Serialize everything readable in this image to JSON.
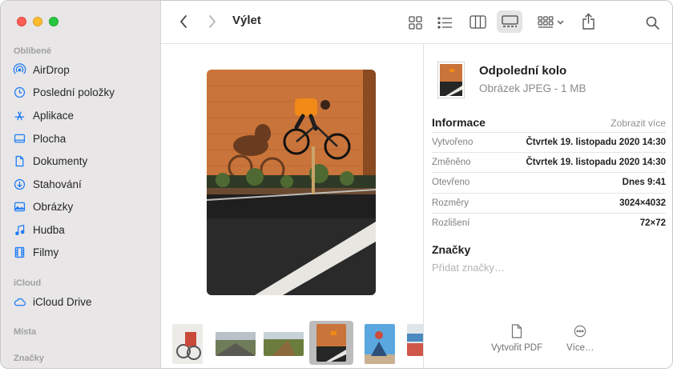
{
  "window": {
    "title": "Výlet"
  },
  "sidebar": {
    "sections": [
      {
        "title": "Oblíbené",
        "items": [
          {
            "label": "AirDrop",
            "icon": "airdrop-icon"
          },
          {
            "label": "Poslední položky",
            "icon": "clock-icon"
          },
          {
            "label": "Aplikace",
            "icon": "applications-icon"
          },
          {
            "label": "Plocha",
            "icon": "desktop-icon"
          },
          {
            "label": "Dokumenty",
            "icon": "document-icon"
          },
          {
            "label": "Stahování",
            "icon": "download-icon"
          },
          {
            "label": "Obrázky",
            "icon": "pictures-icon"
          },
          {
            "label": "Hudba",
            "icon": "music-icon"
          },
          {
            "label": "Filmy",
            "icon": "film-icon"
          }
        ]
      },
      {
        "title": "iCloud",
        "items": [
          {
            "label": "iCloud Drive",
            "icon": "cloud-icon"
          }
        ]
      },
      {
        "title": "Místa",
        "items": []
      },
      {
        "title": "Značky",
        "items": []
      }
    ]
  },
  "info": {
    "file_name": "Odpolední kolo",
    "file_kind": "Obrázek JPEG - 1 MB",
    "heading": "Informace",
    "show_less": "Zobrazit více",
    "rows": [
      {
        "key": "Vytvořeno",
        "value": "Čtvrtek 19. listopadu 2020 14:30"
      },
      {
        "key": "Změněno",
        "value": "Čtvrtek 19. listopadu 2020 14:30"
      },
      {
        "key": "Otevřeno",
        "value": "Dnes 9:41"
      },
      {
        "key": "Rozměry",
        "value": "3024×4032"
      },
      {
        "key": "Rozlišení",
        "value": "72×72"
      }
    ],
    "tags_heading": "Značky",
    "tags_placeholder": "Přidat značky…",
    "actions": [
      {
        "label": "Vytvořit PDF",
        "icon": "document-icon"
      },
      {
        "label": "Více…",
        "icon": "more-icon"
      }
    ]
  },
  "colors": {
    "sidebar_bg": "#e8e6e7",
    "accent": "#1e7cf5",
    "brick": "#c9743a"
  }
}
